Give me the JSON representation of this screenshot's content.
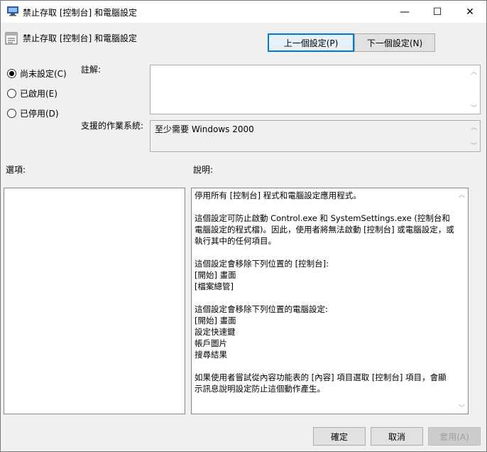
{
  "window": {
    "title": "禁止存取 [控制台] 和電腦設定",
    "controls": {
      "minimize": "—",
      "maximize": "☐",
      "close": "✕"
    }
  },
  "header": {
    "policy_title": "禁止存取 [控制台] 和電腦設定",
    "prev_button": "上一個設定(P)",
    "next_button": "下一個設定(N)"
  },
  "state_options": [
    {
      "label": "尚未設定(C)",
      "checked": true
    },
    {
      "label": "已啟用(E)",
      "checked": false
    },
    {
      "label": "已停用(D)",
      "checked": false
    }
  ],
  "comment": {
    "label": "註解:",
    "value": ""
  },
  "supported_on": {
    "label": "支援的作業系統:",
    "value": "至少需要 Windows 2000"
  },
  "options": {
    "label": "選項:"
  },
  "help": {
    "label": "說明:",
    "text": "停用所有 [控制台] 程式和電腦設定應用程式。\n\n這個設定可防止啟動 Control.exe 和 SystemSettings.exe (控制台和電腦設定的程式檔)。因此，使用者將無法啟動 [控制台] 或電腦設定，或執行其中的任何項目。\n\n這個設定會移除下列位置的 [控制台]:\n[開始] 畫面\n[檔案總管]\n\n這個設定會移除下列位置的電腦設定:\n[開始] 畫面\n設定快速鍵\n帳戶圖片\n搜尋結果\n\n如果使用者嘗試從內容功能表的 [內容] 項目選取 [控制台] 項目，會顯示訊息說明設定防止這個動作產生。"
  },
  "footer": {
    "ok": "確定",
    "cancel": "取消",
    "apply": "套用(A)"
  },
  "colors": {
    "accent": "#0078d7",
    "window_bg": "#f0f0f0"
  }
}
